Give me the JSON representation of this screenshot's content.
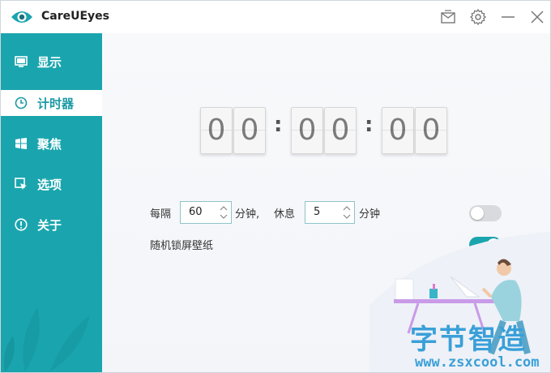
{
  "app": {
    "title": "CareUEyes"
  },
  "sidebar": {
    "items": [
      {
        "label": "显示",
        "icon": "monitor-icon",
        "active": false
      },
      {
        "label": "计时器",
        "icon": "clock-icon",
        "active": true
      },
      {
        "label": "聚焦",
        "icon": "windows-icon",
        "active": false
      },
      {
        "label": "选项",
        "icon": "cursor-icon",
        "active": false
      },
      {
        "label": "关于",
        "icon": "info-icon",
        "active": false
      }
    ]
  },
  "timer": {
    "digits": [
      "0",
      "0",
      "0",
      "0",
      "0",
      "0"
    ],
    "separator": ":"
  },
  "settings": {
    "interval_label": "每隔",
    "interval_value": "60",
    "interval_unit": "分钟,",
    "rest_label": "休息",
    "rest_value": "5",
    "rest_unit": "分钟",
    "break_enabled": false,
    "random_wallpaper_label": "随机锁屏壁纸",
    "random_wallpaper_enabled": true
  },
  "watermark": {
    "chinese": "字节智造",
    "url": "www.zsxcool.com"
  },
  "colors": {
    "accent": "#1aa5ae",
    "sidebar_bg": "#1aa5ae",
    "toggle_off": "#d8dadd",
    "watermark": "#3aa0d8"
  }
}
